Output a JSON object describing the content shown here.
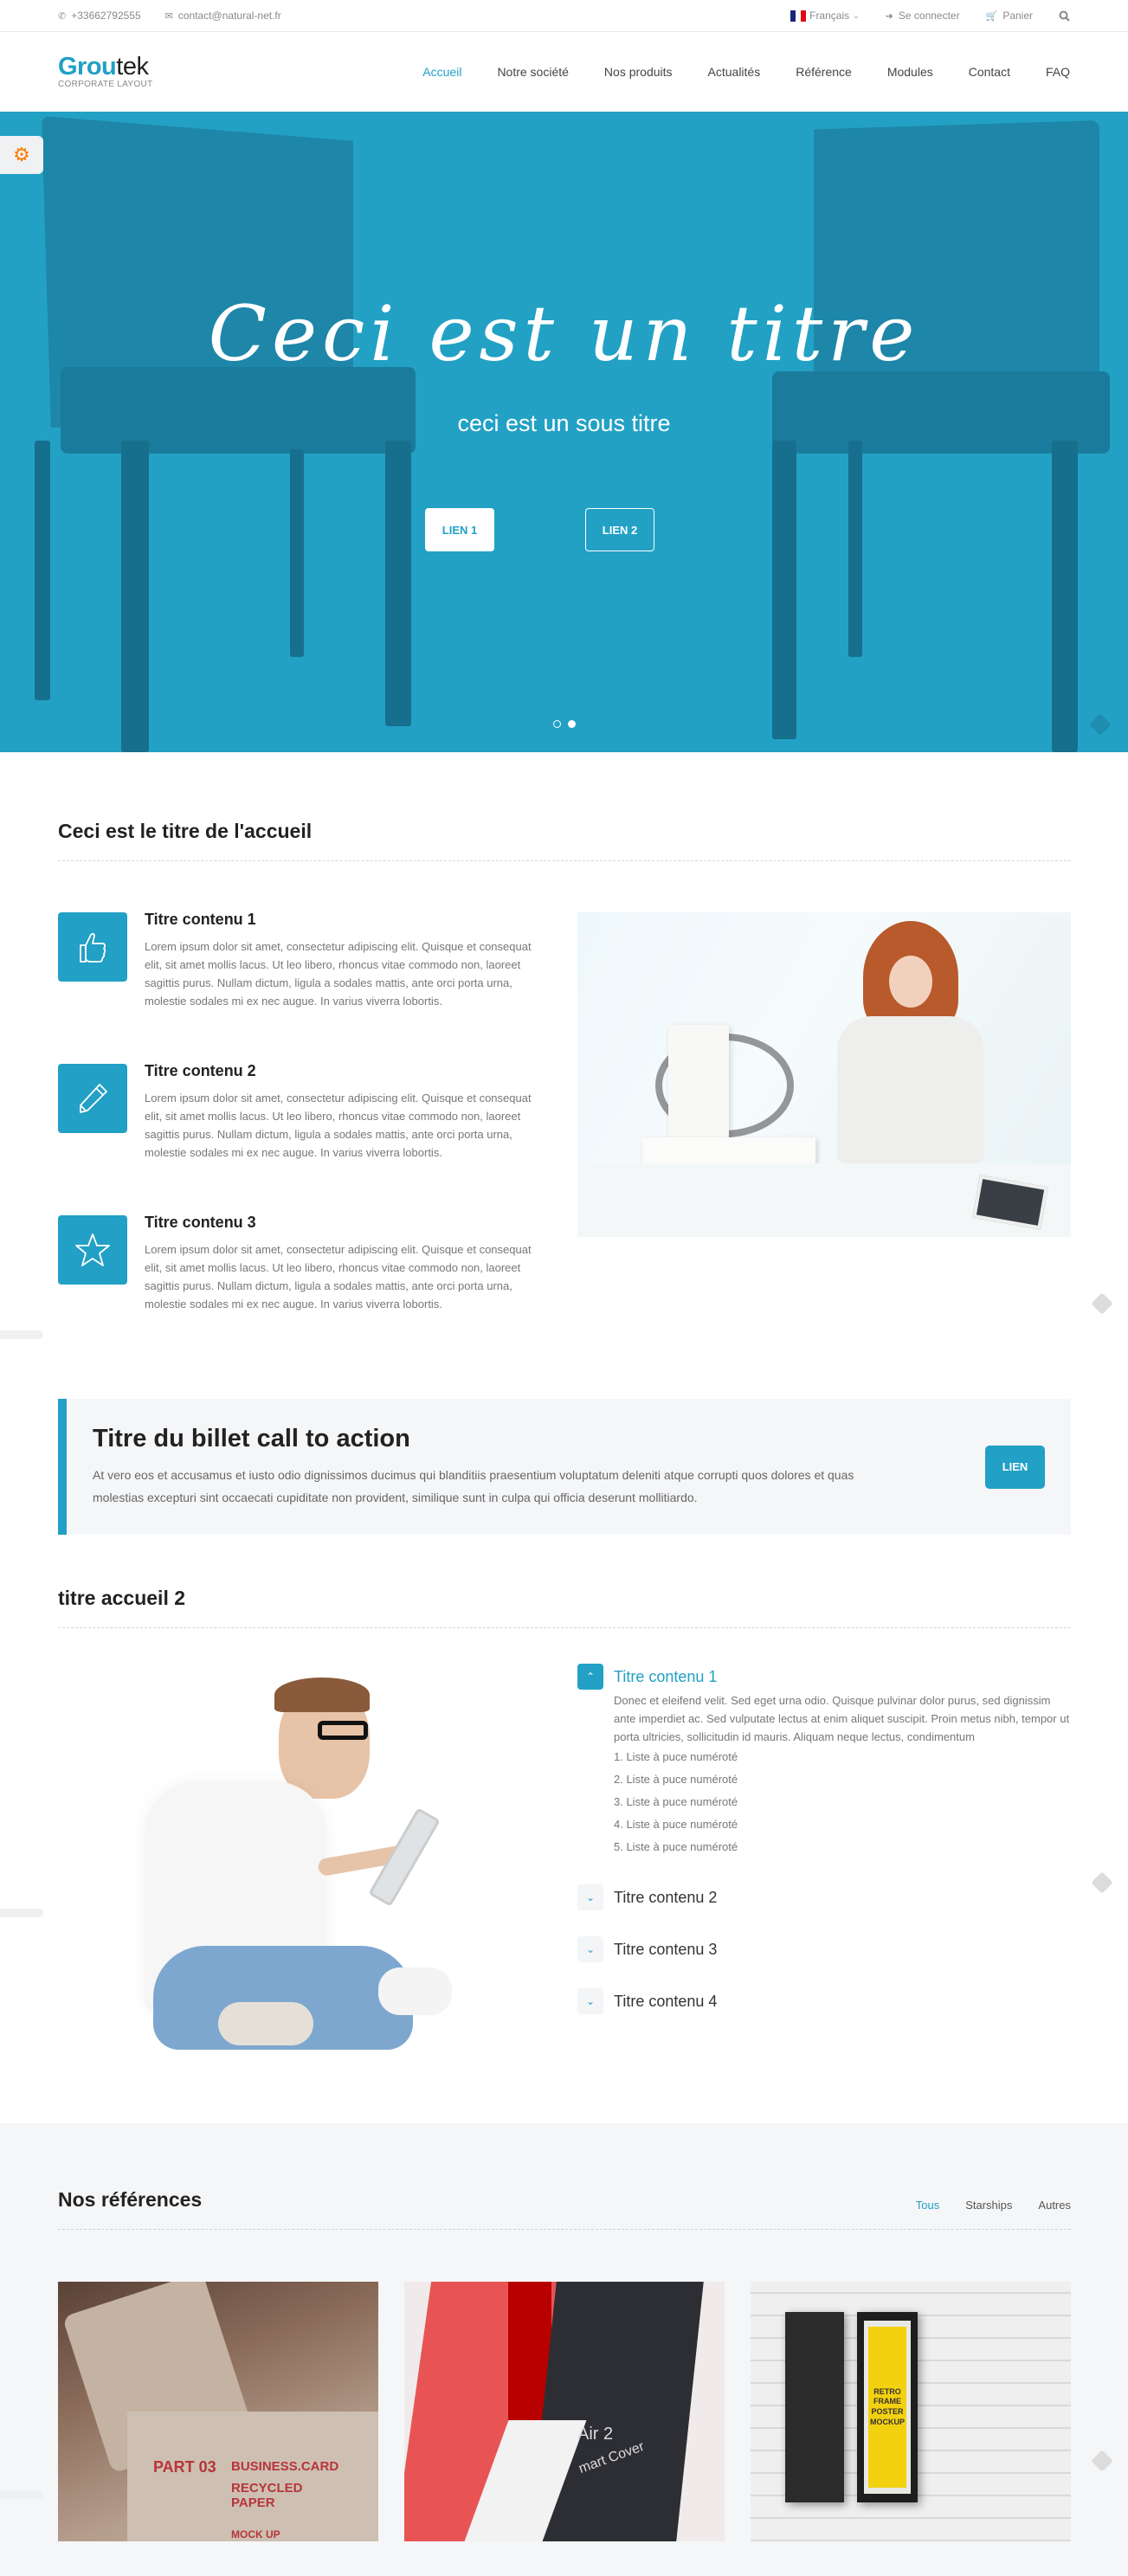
{
  "topbar": {
    "phone": "+33662792555",
    "email": "contact@natural-net.fr",
    "language": "Français",
    "login": "Se connecter",
    "cart": "Panier"
  },
  "header": {
    "logo_part1": "Grou",
    "logo_part2": "tek",
    "logo_tagline": "CORPORATE LAYOUT",
    "nav": [
      {
        "label": "Accueil",
        "active": true
      },
      {
        "label": "Notre société"
      },
      {
        "label": "Nos produits"
      },
      {
        "label": "Actualités"
      },
      {
        "label": "Référence"
      },
      {
        "label": "Modules"
      },
      {
        "label": "Contact"
      },
      {
        "label": "FAQ"
      }
    ]
  },
  "hero": {
    "title": "Ceci est un titre",
    "subtitle": "ceci est un sous titre",
    "button1": "LIEN 1",
    "button2": "LIEN 2",
    "slides_total": 2,
    "active_slide": 2
  },
  "section1": {
    "title": "Ceci est le titre de l'accueil",
    "features": [
      {
        "icon": "thumbs-up-icon",
        "title": "Titre contenu 1",
        "text": "Lorem ipsum dolor sit amet, consectetur adipiscing elit. Quisque et consequat elit, sit amet mollis lacus. Ut leo libero, rhoncus vitae commodo non, laoreet sagittis purus. Nullam dictum, ligula a sodales mattis, ante orci porta urna, molestie sodales mi ex nec augue. In varius viverra lobortis."
      },
      {
        "icon": "pencil-icon",
        "title": "Titre contenu 2",
        "text": "Lorem ipsum dolor sit amet, consectetur adipiscing elit. Quisque et consequat elit, sit amet mollis lacus. Ut leo libero, rhoncus vitae commodo non, laoreet sagittis purus. Nullam dictum, ligula a sodales mattis, ante orci porta urna, molestie sodales mi ex nec augue. In varius viverra lobortis."
      },
      {
        "icon": "star-icon",
        "title": "Titre contenu 3",
        "text": "Lorem ipsum dolor sit amet, consectetur adipiscing elit. Quisque et consequat elit, sit amet mollis lacus. Ut leo libero, rhoncus vitae commodo non, laoreet sagittis purus. Nullam dictum, ligula a sodales mattis, ante orci porta urna, molestie sodales mi ex nec augue. In varius viverra lobortis."
      }
    ]
  },
  "cta": {
    "title": "Titre du billet call to action",
    "text": "At vero eos et accusamus et iusto odio dignissimos ducimus qui blanditiis praesentium voluptatum deleniti atque corrupti quos dolores et quas molestias excepturi sint occaecati cupiditate non provident, similique sunt in culpa qui officia deserunt mollitiardo.",
    "button": "LIEN"
  },
  "section2": {
    "title": "titre accueil 2",
    "accordion": [
      {
        "title": "Titre contenu 1",
        "open": true,
        "text": "Donec et eleifend velit. Sed eget urna odio. Quisque pulvinar dolor purus, sed dignissim ante imperdiet ac. Sed vulputate lectus at enim aliquet suscipit. Proin metus nibh, tempor ut porta ultricies, sollicitudin id mauris. Aliquam neque lectus, condimentum",
        "list": [
          "1. Liste à puce numéroté",
          "2. Liste à puce numéroté",
          "3. Liste à puce numéroté",
          "4. Liste à puce numéroté",
          "5. Liste à puce numéroté"
        ]
      },
      {
        "title": "Titre contenu 2",
        "open": false
      },
      {
        "title": "Titre contenu 3",
        "open": false
      },
      {
        "title": "Titre contenu 4",
        "open": false
      }
    ]
  },
  "references": {
    "title": "Nos références",
    "filters": [
      {
        "label": "Tous",
        "active": true
      },
      {
        "label": "Starships"
      },
      {
        "label": "Autres"
      }
    ],
    "cards": [
      {
        "alt": "Recycled paper business card mockup",
        "texts": [
          "RECYCLED PAPER",
          "PART 03",
          "BUSINESS.CARD",
          "RECYCLED PAPER",
          "MOCK UP"
        ]
      },
      {
        "alt": "iPad Air 2 smart cover",
        "texts": [
          "Air 2",
          "mart Cover"
        ]
      },
      {
        "alt": "Retro frame poster mockup",
        "texts": [
          "RETRO",
          "FRAME",
          "POSTER",
          "MOCKUP"
        ]
      }
    ]
  },
  "colors": {
    "accent": "#22a0c5",
    "hero_bg": "#22a1c5",
    "settings_icon": "#ff7a00",
    "light_bg": "#f5f6f8"
  }
}
